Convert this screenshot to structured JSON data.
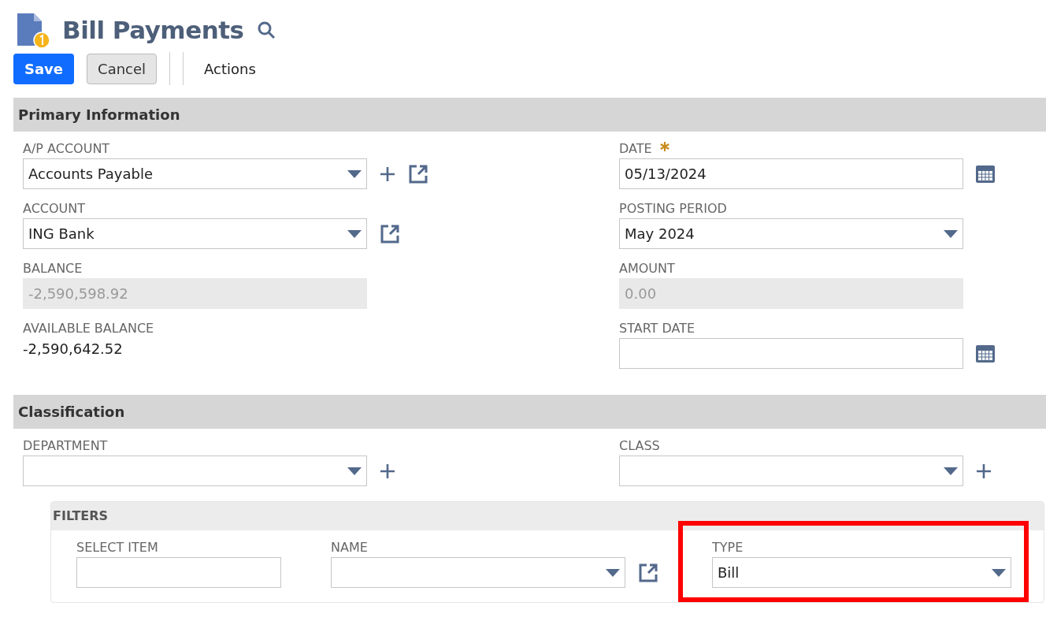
{
  "page": {
    "title": "Bill Payments"
  },
  "toolbar": {
    "buttons": [
      {
        "label": "Save",
        "kind": "primary"
      },
      {
        "label": "Cancel",
        "kind": "secondary"
      }
    ],
    "menu": "Actions"
  },
  "sections": [
    {
      "title": "Primary Information",
      "columns": [
        [
          {
            "label": "A/P ACCOUNT",
            "kind": "select",
            "value": "Accounts Payable",
            "add": true,
            "open": true
          },
          {
            "label": "ACCOUNT",
            "kind": "select",
            "value": "ING Bank",
            "open": true
          },
          {
            "label": "BALANCE",
            "kind": "readonly",
            "value": "-2,590,598.92"
          },
          {
            "label": "AVAILABLE BALANCE",
            "kind": "display",
            "value": "-2,590,642.52"
          }
        ],
        [
          {
            "label": "DATE",
            "kind": "date",
            "value": "05/13/2024",
            "required": true
          },
          {
            "label": "POSTING PERIOD",
            "kind": "select",
            "value": "May 2024"
          },
          {
            "label": "AMOUNT",
            "kind": "readonly",
            "value": "0.00"
          },
          {
            "label": "START DATE",
            "kind": "date"
          }
        ]
      ]
    },
    {
      "title": "Classification",
      "columns": [
        [
          {
            "label": "DEPARTMENT",
            "kind": "select",
            "add": true
          }
        ],
        [
          {
            "label": "CLASS",
            "kind": "select",
            "add": true
          }
        ]
      ]
    }
  ],
  "filters": {
    "title": "FILTERS",
    "fields": [
      {
        "label": "SELECT ITEM",
        "kind": "text",
        "highlighted": false
      },
      {
        "label": "NAME",
        "kind": "select",
        "open": true,
        "highlighted": false
      },
      {
        "label": "TYPE",
        "kind": "select",
        "value": "Bill",
        "highlighted": true
      }
    ]
  }
}
